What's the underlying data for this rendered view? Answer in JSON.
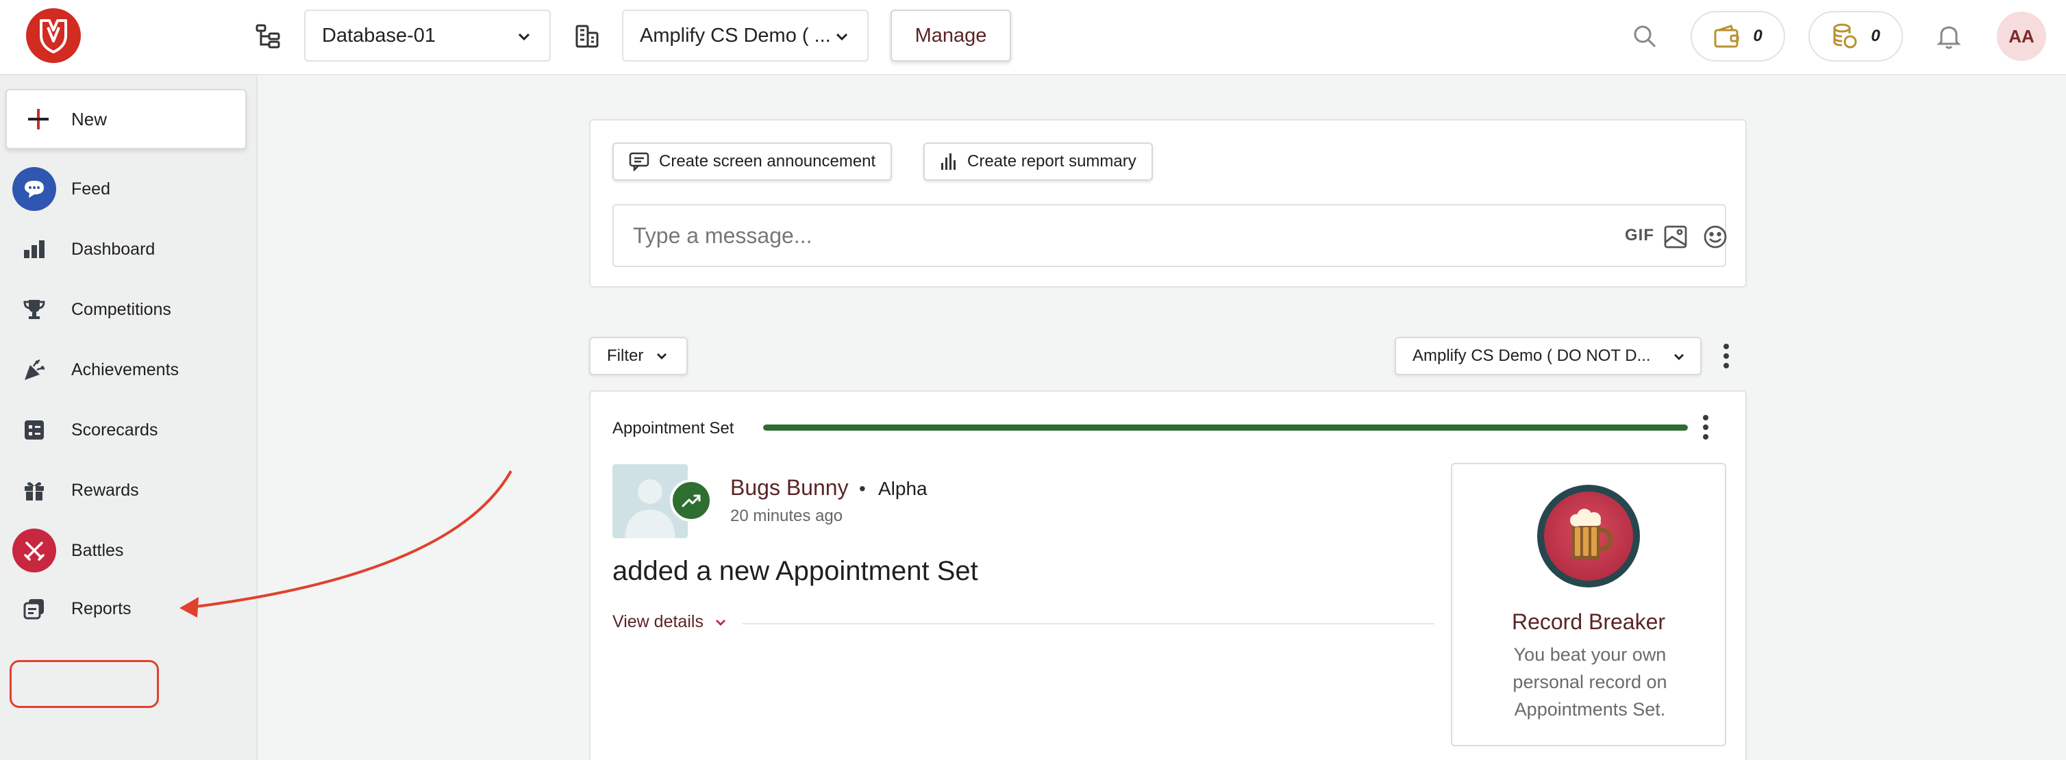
{
  "header": {
    "database_select": "Database-01",
    "org_select": "Amplify CS Demo ( ...",
    "manage_label": "Manage",
    "wallet_count": "0",
    "coins_count": "0",
    "avatar_initials": "AA"
  },
  "sidebar": {
    "new_label": "New",
    "items": [
      {
        "label": "Feed",
        "icon": "chat-bubble-icon"
      },
      {
        "label": "Dashboard",
        "icon": "bar-chart-icon"
      },
      {
        "label": "Competitions",
        "icon": "trophy-icon"
      },
      {
        "label": "Achievements",
        "icon": "party-popper-icon"
      },
      {
        "label": "Scorecards",
        "icon": "scorecard-icon"
      },
      {
        "label": "Rewards",
        "icon": "gift-icon"
      },
      {
        "label": "Battles",
        "icon": "crossed-swords-icon"
      },
      {
        "label": "Reports",
        "icon": "reports-icon"
      }
    ]
  },
  "composer": {
    "announcement_label": "Create screen announcement",
    "report_summary_label": "Create report summary",
    "message_placeholder": "Type a message...",
    "gif_label": "GIF"
  },
  "feed": {
    "filter_label": "Filter",
    "scope_select": "Amplify CS Demo ( DO NOT D...",
    "card": {
      "title": "Appointment Set",
      "progress": 1.0,
      "user_name": "Bugs Bunny",
      "separator": "•",
      "team": "Alpha",
      "time": "20 minutes ago",
      "activity": "added a new Appointment Set",
      "view_details": "View details",
      "badge": {
        "title": "Record Breaker",
        "description": "You beat your own personal record on Appointments Set."
      }
    }
  },
  "colors": {
    "brand_red": "#d12b22",
    "accent_maroon": "#5b2426",
    "progress_green": "#2e6b34",
    "highlight": "#e0412c"
  }
}
